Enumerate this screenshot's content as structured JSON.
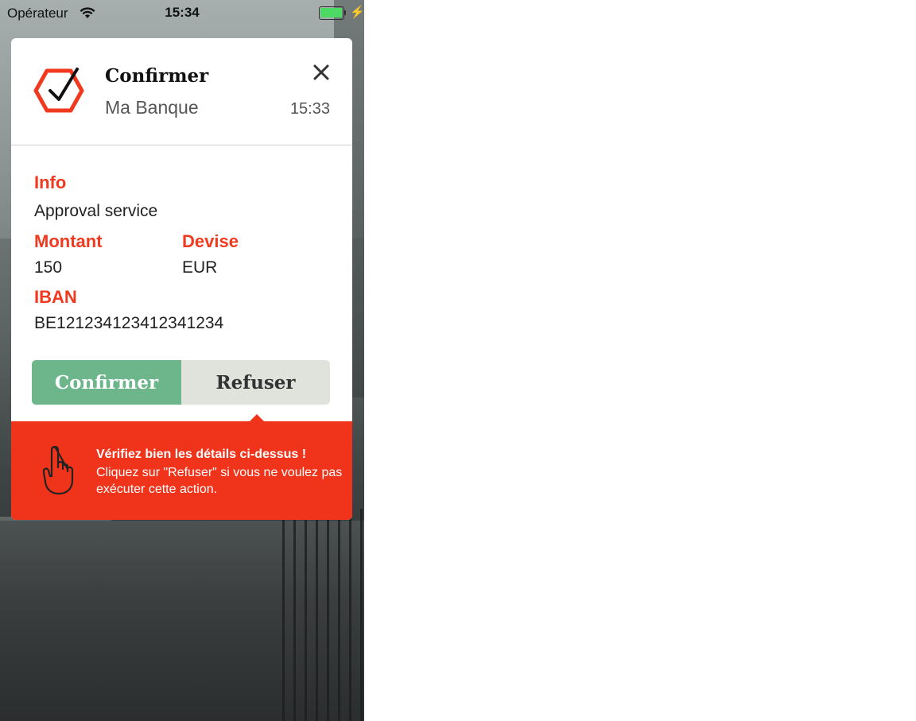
{
  "status_bar": {
    "carrier": "Opérateur",
    "time": "15:34",
    "battery_level_pct": 100,
    "icons": [
      "wifi-icon",
      "battery-icon",
      "charging-bolt-icon"
    ]
  },
  "card": {
    "logo_icon": "hexagon-check-icon",
    "title": "Confirmer",
    "subtitle": "Ma Banque",
    "time": "15:33",
    "close_icon": "close-icon",
    "fields": {
      "info_label": "Info",
      "info_value": "Approval service",
      "amount_label": "Montant",
      "amount_value": "150",
      "currency_label": "Devise",
      "currency_value": "EUR",
      "iban_label": "IBAN",
      "iban_value": "BE121234123412341234"
    },
    "buttons": {
      "confirm_label": "Confirmer",
      "refuse_label": "Refuser"
    }
  },
  "warning": {
    "icon": "raised-finger-hand-icon",
    "title": "Vérifiez bien les détails ci-dessus !",
    "text": "Cliquez sur \"Refuser\" si vous ne voulez pas exécuter cette action."
  },
  "colors": {
    "accent_red": "#f0391e",
    "confirm_green": "#6db68c",
    "refuse_gray": "#dfe3dc",
    "battery_green": "#4cd964"
  }
}
